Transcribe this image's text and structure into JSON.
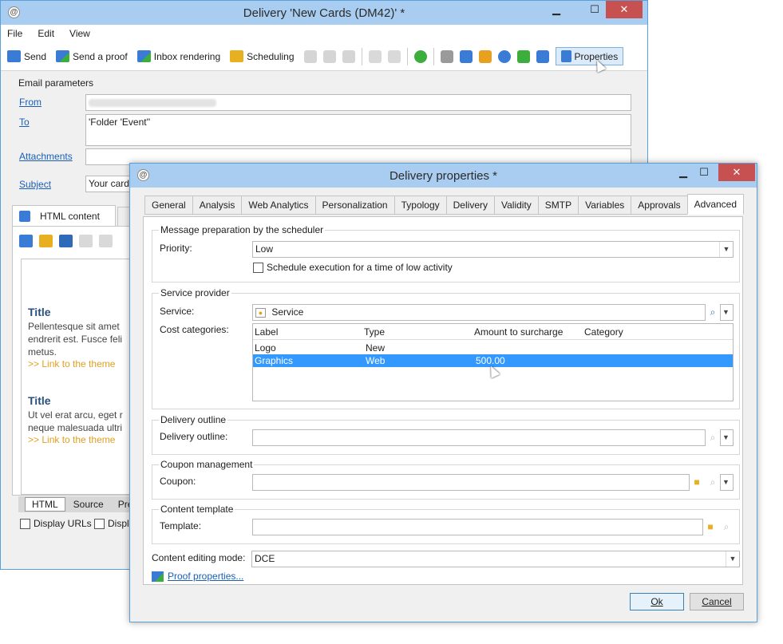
{
  "main_window": {
    "title": "Delivery 'New Cards (DM42)' *",
    "menu": [
      "File",
      "Edit",
      "View"
    ],
    "toolbar": {
      "send": "Send",
      "send_proof": "Send a proof",
      "inbox_rendering": "Inbox rendering",
      "scheduling": "Scheduling",
      "properties": "Properties"
    },
    "email_params": {
      "legend": "Email parameters",
      "from_label": "From",
      "to_label": "To",
      "to_value": "'Folder 'Event''",
      "attachments_label": "Attachments",
      "subject_label": "Subject",
      "subject_value": "Your card"
    },
    "content_tabs": {
      "html_content": "HTML content"
    },
    "preview": {
      "title1": "Title",
      "text1a": "Pellentesque sit amet",
      "text1b": "endrerit est. Fusce feli",
      "text1c": "metus.",
      "link1": ">> Link to the theme",
      "title2": "Title",
      "text2a": "Ut vel erat arcu, eget r",
      "text2b": "neque malesuada ultri",
      "link2": ">> Link to the theme"
    },
    "bottom_tabs": [
      "HTML",
      "Source",
      "Pre"
    ],
    "display_urls": "Display URLs",
    "display_other": "Displa"
  },
  "dialog": {
    "title": "Delivery properties *",
    "tabs": [
      "General",
      "Analysis",
      "Web Analytics",
      "Personalization",
      "Typology",
      "Delivery",
      "Validity",
      "SMTP",
      "Variables",
      "Approvals",
      "Advanced"
    ],
    "active_tab": "Advanced",
    "scheduler": {
      "legend": "Message preparation by the scheduler",
      "priority_label": "Priority:",
      "priority_value": "Low",
      "low_activity_label": "Schedule execution for a time of low activity"
    },
    "service_provider": {
      "legend": "Service provider",
      "service_label": "Service:",
      "service_value": "Service",
      "cost_label": "Cost categories:",
      "columns": [
        "Label",
        "Type",
        "Amount to surcharge",
        "Category"
      ],
      "rows": [
        {
          "label": "Logo",
          "type": "New",
          "amount": "",
          "category": ""
        },
        {
          "label": "Graphics",
          "type": "Web",
          "amount": "500.00",
          "category": ""
        }
      ]
    },
    "delivery_outline": {
      "legend": "Delivery outline",
      "label": "Delivery outline:",
      "value": ""
    },
    "coupon": {
      "legend": "Coupon management",
      "label": "Coupon:",
      "value": ""
    },
    "content_template": {
      "legend": "Content template",
      "label": "Template:",
      "value": ""
    },
    "editing_mode": {
      "label": "Content editing mode:",
      "value": "DCE"
    },
    "proof_link": "Proof properties...",
    "buttons": {
      "ok": "Ok",
      "cancel": "Cancel"
    }
  },
  "colors": {
    "titlebar": "#a9cdf0",
    "close": "#c75050",
    "selection": "#3399ff",
    "link": "#1a5fb4",
    "accent_orange": "#e0a020"
  }
}
